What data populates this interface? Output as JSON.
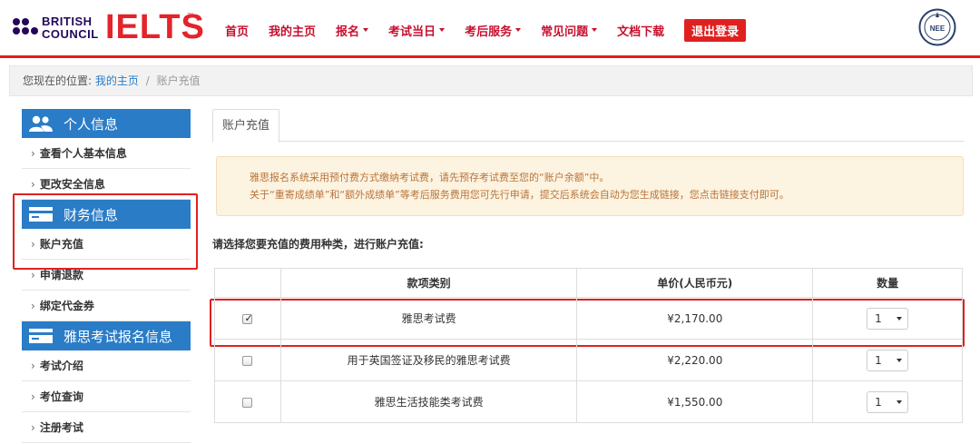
{
  "brand": {
    "council_line1": "BRITISH",
    "council_line2": "COUNCIL",
    "ielts": "IELTS",
    "ielts_tm": "™",
    "nee_logo_text": "NEE",
    "accent_color": "#e02020",
    "primary_blue": "#2a7cc7"
  },
  "nav": {
    "items": [
      {
        "label": "首页",
        "has_dropdown": false
      },
      {
        "label": "我的主页",
        "has_dropdown": false
      },
      {
        "label": "报名",
        "has_dropdown": true
      },
      {
        "label": "考试当日",
        "has_dropdown": true
      },
      {
        "label": "考后服务",
        "has_dropdown": true
      },
      {
        "label": "常见问题",
        "has_dropdown": true
      },
      {
        "label": "文档下载",
        "has_dropdown": false
      }
    ],
    "logout_label": "退出登录"
  },
  "breadcrumb": {
    "prefix": "您现在的位置:",
    "link": "我的主页",
    "separator": "/",
    "current": "账户充值"
  },
  "sidebar": {
    "sections": [
      {
        "title": "个人信息",
        "icon": "users-icon",
        "items": [
          "查看个人基本信息",
          "更改安全信息"
        ]
      },
      {
        "title": "财务信息",
        "icon": "card-icon",
        "items": [
          "账户充值",
          "申请退款",
          "绑定代金券"
        ]
      },
      {
        "title": "雅思考试报名信息",
        "icon": "card-icon",
        "items": [
          "考试介绍",
          "考位查询",
          "注册考试"
        ]
      }
    ],
    "item_prefix": "›"
  },
  "main": {
    "tab_label": "账户充值",
    "notice_line1": "雅思报名系统采用预付费方式缴纳考试费，请先预存考试费至您的“账户余额”中。",
    "notice_line2": "关于“重寄成绩单”和“额外成绩单”等考后服务费用您可先行申请，提交后系统会自动为您生成链接，您点击链接支付即可。",
    "instruction": "请选择您要充值的费用种类，进行账户充值:",
    "table": {
      "headers": [
        "",
        "款项类别",
        "单价(人民币元)",
        "数量"
      ],
      "rows": [
        {
          "checked": true,
          "category": "雅思考试费",
          "price": "¥2,170.00",
          "quantity": "1"
        },
        {
          "checked": false,
          "category": "用于英国签证及移民的雅思考试费",
          "price": "¥2,220.00",
          "quantity": "1"
        },
        {
          "checked": false,
          "category": "雅思生活技能类考试费",
          "price": "¥1,550.00",
          "quantity": "1"
        }
      ]
    }
  }
}
